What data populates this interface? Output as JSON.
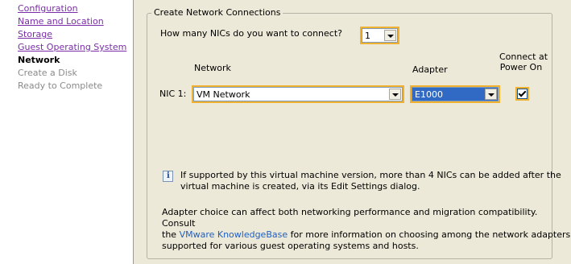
{
  "sidebar": {
    "items": [
      {
        "label": "Configuration",
        "state": "done"
      },
      {
        "label": "Name and Location",
        "state": "done"
      },
      {
        "label": "Storage",
        "state": "done"
      },
      {
        "label": "Guest Operating System",
        "state": "done"
      },
      {
        "label": "Network",
        "state": "current"
      },
      {
        "label": "Create a Disk",
        "state": "pending"
      },
      {
        "label": "Ready to Complete",
        "state": "pending"
      }
    ]
  },
  "group": {
    "title": "Create Network Connections",
    "nic_count_question": "How many NICs do you want to connect?",
    "nic_count_value": "1",
    "headers": {
      "network": "Network",
      "adapter": "Adapter",
      "connect_line1": "Connect at",
      "connect_line2": "Power On"
    },
    "nic1": {
      "label": "NIC 1:",
      "network": "VM Network",
      "adapter": "E1000",
      "connect_at_power_on": true
    },
    "info_line1": "If supported by this virtual machine version, more than 4 NICs can be added after the",
    "info_line2": "virtual machine is created, via its Edit Settings dialog.",
    "adapter_note_line1": "Adapter choice can affect both networking performance and migration compatibility. Consult",
    "adapter_note_pre": "the ",
    "adapter_note_link": "VMware KnowledgeBase",
    "adapter_note_post": " for more information on choosing among the network adapters",
    "adapter_note_line3": "supported for various guest operating systems and hosts."
  },
  "colors": {
    "link_visited": "#7b2da8",
    "focus_highlight": "#f0b030",
    "selection": "#316ac5",
    "kb_link": "#1f5fc4"
  }
}
